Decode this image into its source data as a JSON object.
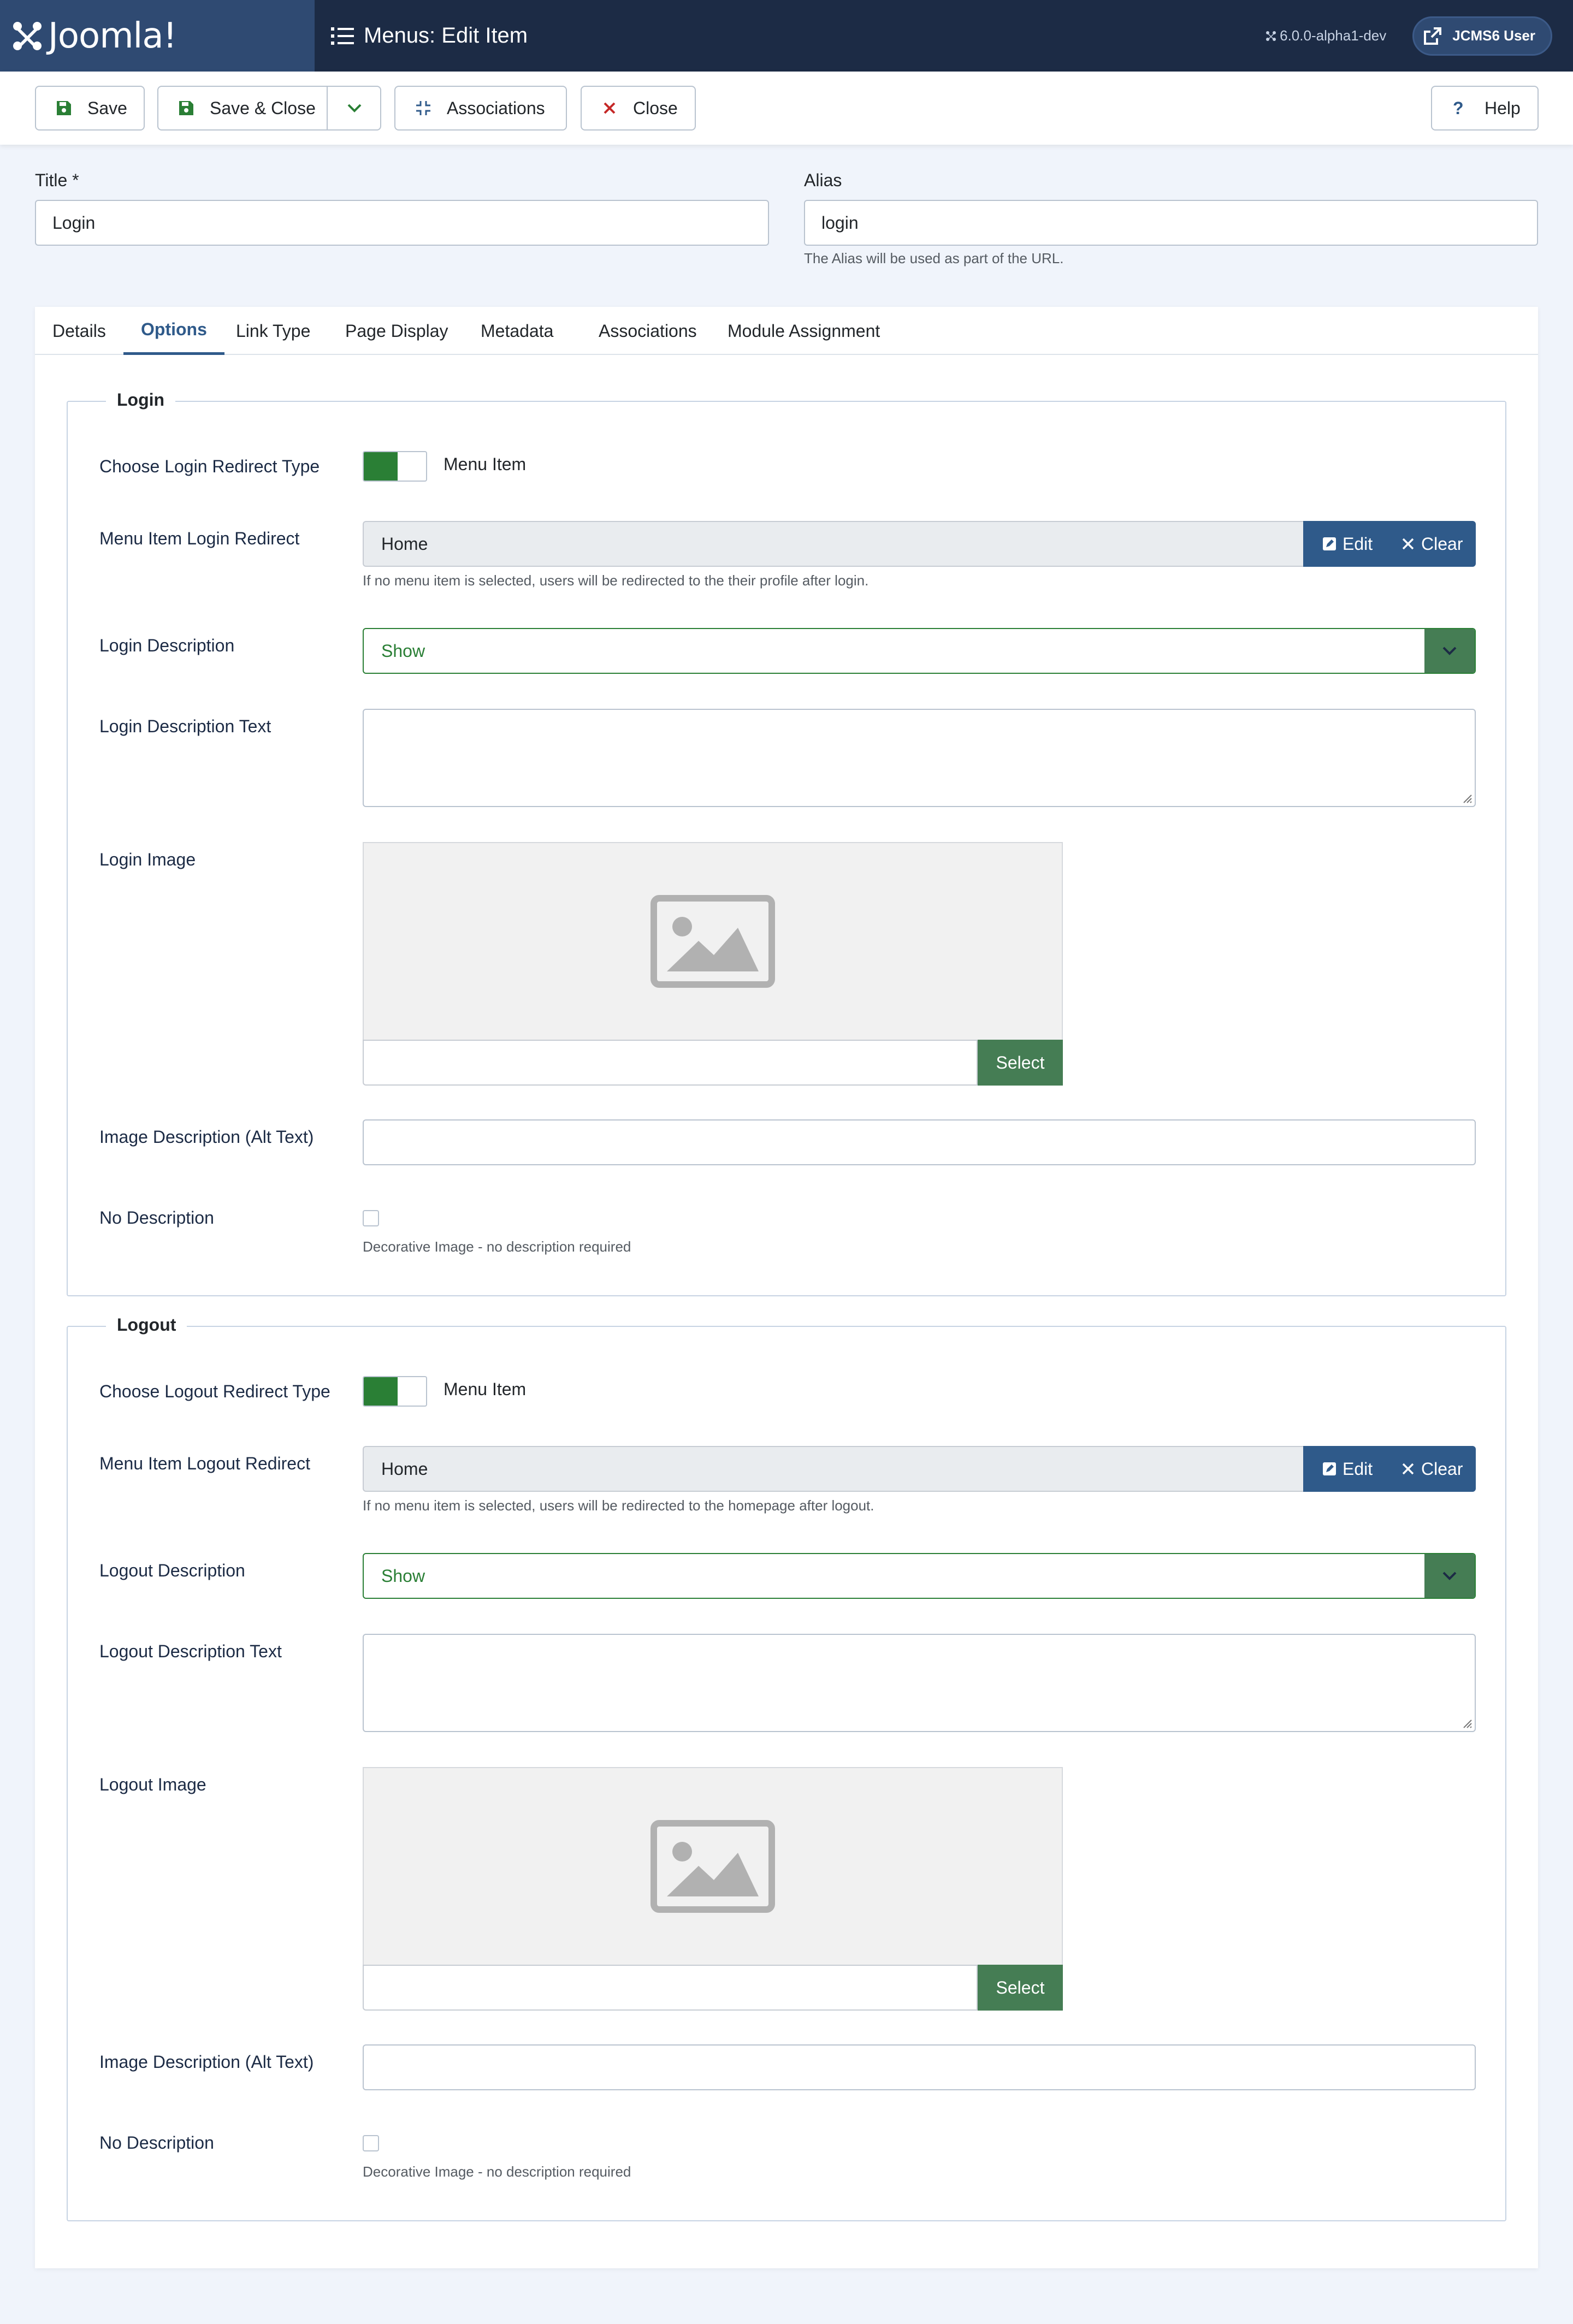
{
  "header": {
    "brand": "Joomla!",
    "page_title": "Menus: Edit Item",
    "version": "6.0.0-alpha1-dev",
    "user_button": "JCMS6 User"
  },
  "toolbar": {
    "save": "Save",
    "save_close": "Save & Close",
    "associations": "Associations",
    "close": "Close",
    "help": "Help"
  },
  "form": {
    "title_label": "Title *",
    "title_value": "Login",
    "alias_label": "Alias",
    "alias_value": "login",
    "alias_hint": "The Alias will be used as part of the URL."
  },
  "tabs": [
    "Details",
    "Options",
    "Link Type",
    "Page Display",
    "Metadata",
    "Associations",
    "Module Assignment"
  ],
  "login": {
    "legend": "Login",
    "redirect_type_label": "Choose Login Redirect Type",
    "redirect_type_value": "Menu Item",
    "redirect_label": "Menu Item Login Redirect",
    "redirect_value": "Home",
    "edit": "Edit",
    "clear": "Clear",
    "redirect_hint": "If no menu item is selected, users will be redirected to the their profile after login.",
    "description_label": "Login Description",
    "description_value": "Show",
    "description_text_label": "Login Description Text",
    "image_label": "Login Image",
    "select": "Select",
    "alt_label": "Image Description (Alt Text)",
    "no_desc_label": "No Description",
    "no_desc_hint": "Decorative Image - no description required"
  },
  "logout": {
    "legend": "Logout",
    "redirect_type_label": "Choose Logout Redirect Type",
    "redirect_type_value": "Menu Item",
    "redirect_label": "Menu Item Logout Redirect",
    "redirect_value": "Home",
    "edit": "Edit",
    "clear": "Clear",
    "redirect_hint": "If no menu item is selected, users will be redirected to the homepage after logout.",
    "description_label": "Logout Description",
    "description_value": "Show",
    "description_text_label": "Logout Description Text",
    "image_label": "Logout Image",
    "select": "Select",
    "alt_label": "Image Description (Alt Text)",
    "no_desc_label": "No Description",
    "no_desc_hint": "Decorative Image - no description required"
  },
  "colors": {
    "header_bg": "#1c2b45",
    "logo_bg": "#2f4a72",
    "accent_blue": "#2f5a8a",
    "accent_green": "#2a7f35",
    "select_green": "#457d54"
  }
}
